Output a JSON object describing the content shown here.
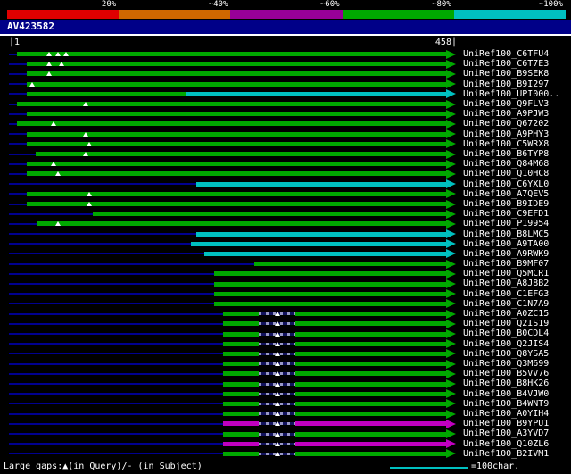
{
  "header": {
    "scale_labels": [
      "20%",
      "~40%",
      "~60%",
      "~80%",
      "~100%"
    ],
    "scale_colors": [
      "#e00000",
      "#d06800",
      "#980098",
      "#00a800",
      "#00c0c0"
    ]
  },
  "query": {
    "name": "AV423582",
    "ruler_left": "|1",
    "ruler_right": "458|"
  },
  "footer": {
    "gaps_legend": "Large gaps:▲(in Query)/- (in Subject)",
    "unit_label": "=100char."
  },
  "colors": {
    "background": "#000000",
    "text": "#ffffff",
    "title_bg": "#000088",
    "query_line": "#000090",
    "green": "#00a800",
    "cyan": "#00c0c0",
    "magenta": "#c000c0",
    "red": "#e00000",
    "orange": "#d06800",
    "purple": "#980098"
  },
  "chart_data": {
    "type": "bar",
    "subtype": "blast-alignment-overview",
    "title": "AV423582",
    "query_length": 458,
    "x_range": [
      1,
      458
    ],
    "x_unit": "query position (characters)",
    "legend_position": "top",
    "identity_legend": [
      {
        "label": "20%",
        "color": "#e00000"
      },
      {
        "label": "~40%",
        "color": "#d06800"
      },
      {
        "label": "~60%",
        "color": "#980098"
      },
      {
        "label": "~80%",
        "color": "#00a800"
      },
      {
        "label": "~100%",
        "color": "#00c0c0"
      }
    ],
    "hits": [
      {
        "name": "UniRef100_C6TFU4",
        "segments": [
          [
            8,
            458,
            "green"
          ]
        ],
        "query_gaps": [
          42,
          51,
          60
        ],
        "subject_gaps": []
      },
      {
        "name": "UniRef100_C6T7E3",
        "segments": [
          [
            19,
            458,
            "green"
          ]
        ],
        "query_gaps": [
          42,
          55
        ],
        "subject_gaps": []
      },
      {
        "name": "UniRef100_B9SEK8",
        "segments": [
          [
            19,
            458,
            "green"
          ]
        ],
        "query_gaps": [
          42
        ],
        "subject_gaps": []
      },
      {
        "name": "UniRef100_B9I297",
        "segments": [
          [
            19,
            458,
            "green"
          ]
        ],
        "query_gaps": [
          24
        ],
        "subject_gaps": []
      },
      {
        "name": "UniRef100_UPI000..",
        "segments": [
          [
            19,
            186,
            "green"
          ],
          [
            186,
            458,
            "cyan"
          ]
        ],
        "query_gaps": [],
        "subject_gaps": []
      },
      {
        "name": "UniRef100_Q9FLV3",
        "segments": [
          [
            8,
            458,
            "green"
          ]
        ],
        "query_gaps": [
          80
        ],
        "subject_gaps": []
      },
      {
        "name": "UniRef100_A9PJW3",
        "segments": [
          [
            19,
            458,
            "green"
          ]
        ],
        "query_gaps": [],
        "subject_gaps": []
      },
      {
        "name": "UniRef100_Q67202",
        "segments": [
          [
            8,
            458,
            "green"
          ]
        ],
        "query_gaps": [
          47
        ],
        "subject_gaps": []
      },
      {
        "name": "UniRef100_A9PHY3",
        "segments": [
          [
            19,
            458,
            "green"
          ]
        ],
        "query_gaps": [
          80
        ],
        "subject_gaps": []
      },
      {
        "name": "UniRef100_C5WRX8",
        "segments": [
          [
            19,
            458,
            "green"
          ]
        ],
        "query_gaps": [
          84
        ],
        "subject_gaps": []
      },
      {
        "name": "UniRef100_B6TYP8",
        "segments": [
          [
            28,
            458,
            "green"
          ]
        ],
        "query_gaps": [
          80
        ],
        "subject_gaps": []
      },
      {
        "name": "UniRef100_Q84M68",
        "segments": [
          [
            19,
            458,
            "green"
          ]
        ],
        "query_gaps": [
          47
        ],
        "subject_gaps": []
      },
      {
        "name": "UniRef100_Q10HC8",
        "segments": [
          [
            19,
            458,
            "green"
          ]
        ],
        "query_gaps": [
          51
        ],
        "subject_gaps": []
      },
      {
        "name": "UniRef100_C6YXL0",
        "segments": [
          [
            196,
            458,
            "cyan"
          ]
        ],
        "query_gaps": [],
        "subject_gaps": []
      },
      {
        "name": "UniRef100_A7QEV5",
        "segments": [
          [
            19,
            458,
            "green"
          ]
        ],
        "query_gaps": [
          84
        ],
        "subject_gaps": []
      },
      {
        "name": "UniRef100_B9IDE9",
        "segments": [
          [
            19,
            458,
            "green"
          ]
        ],
        "query_gaps": [
          84
        ],
        "subject_gaps": []
      },
      {
        "name": "UniRef100_C9EFD1",
        "segments": [
          [
            88,
            458,
            "green"
          ]
        ],
        "query_gaps": [],
        "subject_gaps": []
      },
      {
        "name": "UniRef100_P19954",
        "segments": [
          [
            30,
            458,
            "green"
          ]
        ],
        "query_gaps": [
          51
        ],
        "subject_gaps": []
      },
      {
        "name": "UniRef100_B8LMC5",
        "segments": [
          [
            196,
            458,
            "cyan"
          ]
        ],
        "query_gaps": [],
        "subject_gaps": []
      },
      {
        "name": "UniRef100_A9TA00",
        "segments": [
          [
            191,
            458,
            "cyan"
          ]
        ],
        "query_gaps": [],
        "subject_gaps": []
      },
      {
        "name": "UniRef100_A9RWK9",
        "segments": [
          [
            205,
            458,
            "cyan"
          ]
        ],
        "query_gaps": [],
        "subject_gaps": []
      },
      {
        "name": "UniRef100_B9MF07",
        "segments": [
          [
            257,
            458,
            "green"
          ]
        ],
        "query_gaps": [],
        "subject_gaps": []
      },
      {
        "name": "UniRef100_Q5MCR1",
        "segments": [
          [
            215,
            458,
            "green"
          ]
        ],
        "query_gaps": [],
        "subject_gaps": []
      },
      {
        "name": "UniRef100_A8J8B2",
        "segments": [
          [
            215,
            458,
            "green"
          ]
        ],
        "query_gaps": [],
        "subject_gaps": []
      },
      {
        "name": "UniRef100_C1EFG3",
        "segments": [
          [
            215,
            458,
            "green"
          ]
        ],
        "query_gaps": [],
        "subject_gaps": []
      },
      {
        "name": "UniRef100_C1N7A9",
        "segments": [
          [
            215,
            458,
            "green"
          ]
        ],
        "query_gaps": [],
        "subject_gaps": []
      },
      {
        "name": "UniRef100_A0ZC15",
        "segments": [
          [
            224,
            262,
            "green"
          ],
          [
            300,
            458,
            "green"
          ]
        ],
        "query_gaps": [
          281
        ],
        "subject_gaps": [
          [
            262,
            300
          ]
        ]
      },
      {
        "name": "UniRef100_Q2IS19",
        "segments": [
          [
            224,
            262,
            "green"
          ],
          [
            300,
            458,
            "green"
          ]
        ],
        "query_gaps": [
          281
        ],
        "subject_gaps": [
          [
            262,
            300
          ]
        ]
      },
      {
        "name": "UniRef100_B0CDL4",
        "segments": [
          [
            224,
            262,
            "green"
          ],
          [
            300,
            458,
            "green"
          ]
        ],
        "query_gaps": [
          281
        ],
        "subject_gaps": [
          [
            262,
            300
          ]
        ]
      },
      {
        "name": "UniRef100_Q2JIS4",
        "segments": [
          [
            224,
            262,
            "green"
          ],
          [
            300,
            458,
            "green"
          ]
        ],
        "query_gaps": [
          281
        ],
        "subject_gaps": [
          [
            262,
            300
          ]
        ]
      },
      {
        "name": "UniRef100_Q8YSA5",
        "segments": [
          [
            224,
            262,
            "green"
          ],
          [
            300,
            458,
            "green"
          ]
        ],
        "query_gaps": [
          281
        ],
        "subject_gaps": [
          [
            262,
            300
          ]
        ]
      },
      {
        "name": "UniRef100_Q3M699",
        "segments": [
          [
            224,
            262,
            "green"
          ],
          [
            300,
            458,
            "green"
          ]
        ],
        "query_gaps": [
          281
        ],
        "subject_gaps": [
          [
            262,
            300
          ]
        ]
      },
      {
        "name": "UniRef100_B5VV76",
        "segments": [
          [
            224,
            262,
            "green"
          ],
          [
            300,
            458,
            "green"
          ]
        ],
        "query_gaps": [
          281
        ],
        "subject_gaps": [
          [
            262,
            300
          ]
        ]
      },
      {
        "name": "UniRef100_B8HK26",
        "segments": [
          [
            224,
            262,
            "green"
          ],
          [
            300,
            458,
            "green"
          ]
        ],
        "query_gaps": [
          281
        ],
        "subject_gaps": [
          [
            262,
            300
          ]
        ]
      },
      {
        "name": "UniRef100_B4VJW0",
        "segments": [
          [
            224,
            262,
            "green"
          ],
          [
            300,
            458,
            "green"
          ]
        ],
        "query_gaps": [
          281
        ],
        "subject_gaps": [
          [
            262,
            300
          ]
        ]
      },
      {
        "name": "UniRef100_B4WNT9",
        "segments": [
          [
            224,
            262,
            "green"
          ],
          [
            300,
            458,
            "green"
          ]
        ],
        "query_gaps": [
          281
        ],
        "subject_gaps": [
          [
            262,
            300
          ]
        ]
      },
      {
        "name": "UniRef100_A0YIH4",
        "segments": [
          [
            224,
            262,
            "green"
          ],
          [
            300,
            458,
            "green"
          ]
        ],
        "query_gaps": [
          281
        ],
        "subject_gaps": [
          [
            262,
            300
          ]
        ]
      },
      {
        "name": "UniRef100_B9YPU1",
        "segments": [
          [
            224,
            262,
            "magenta"
          ],
          [
            300,
            458,
            "magenta"
          ]
        ],
        "query_gaps": [
          281
        ],
        "subject_gaps": [
          [
            262,
            300
          ]
        ]
      },
      {
        "name": "UniRef100_A3YVD7",
        "segments": [
          [
            224,
            262,
            "green"
          ],
          [
            300,
            458,
            "green"
          ]
        ],
        "query_gaps": [
          281
        ],
        "subject_gaps": [
          [
            262,
            300
          ]
        ]
      },
      {
        "name": "UniRef100_Q10ZL6",
        "segments": [
          [
            224,
            262,
            "magenta"
          ],
          [
            300,
            458,
            "magenta"
          ]
        ],
        "query_gaps": [
          281
        ],
        "subject_gaps": [
          [
            262,
            300
          ]
        ]
      },
      {
        "name": "UniRef100_B2IVM1",
        "segments": [
          [
            224,
            262,
            "green"
          ],
          [
            300,
            458,
            "green"
          ]
        ],
        "query_gaps": [
          281
        ],
        "subject_gaps": [
          [
            262,
            300
          ]
        ]
      }
    ]
  }
}
